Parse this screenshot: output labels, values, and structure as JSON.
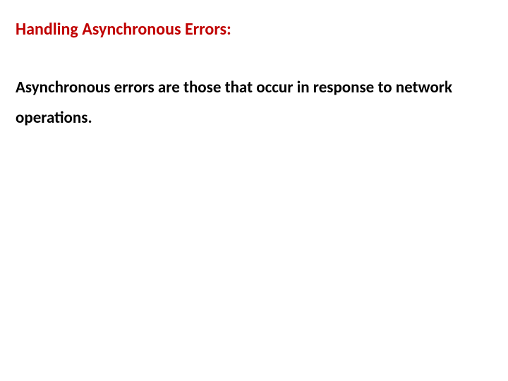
{
  "heading": "Handling Asynchronous Errors:",
  "body": "Asynchronous errors are those that occur in response to network operations."
}
